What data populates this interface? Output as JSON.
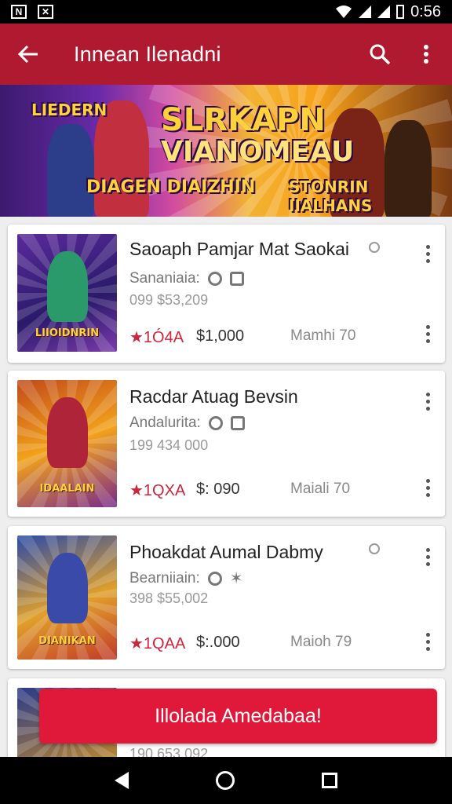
{
  "status_bar": {
    "time": "0:56"
  },
  "app_bar": {
    "title": "Innean Ilenadni"
  },
  "banner": {
    "line1": "LIEDERN",
    "line2": "SLRKAPN",
    "line3": "VIANOMEAU",
    "line4": "DIAGEN DIAIZHIN",
    "line5": "STONRIN IIALHANS"
  },
  "items": [
    {
      "title": "Saoaph Pamjar Mat Saokai",
      "subtitle": "Sananiaia:",
      "number": "099 $53,209",
      "rating": "★1Ó4A",
      "price": "$1,000",
      "meta": "Mamhi 70",
      "thumb_logo": "LIIOIDNRIN"
    },
    {
      "title": "Racdar Atuag Bevsin",
      "subtitle": "Andalurita:",
      "number": "199 434 000",
      "rating": "★1QXA",
      "price": "$: 090",
      "meta": "Maiali 70",
      "thumb_logo": "IDAALAIN"
    },
    {
      "title": "Phoakdat Aumal Dabmy",
      "subtitle": "Bearniiain:",
      "number": "398 $55,002",
      "rating": "★1QAA",
      "price": "$:.000",
      "meta": "Maioh 79",
      "thumb_logo": "DIANIKAN"
    },
    {
      "title": "",
      "subtitle": "",
      "number": "190 653 092",
      "rating": "",
      "price": "",
      "meta": "",
      "thumb_logo": ""
    }
  ],
  "cta": {
    "label": "Illolada Amedabaa!"
  },
  "colors": {
    "primary": "#b01a30",
    "accent": "#e0183a"
  }
}
